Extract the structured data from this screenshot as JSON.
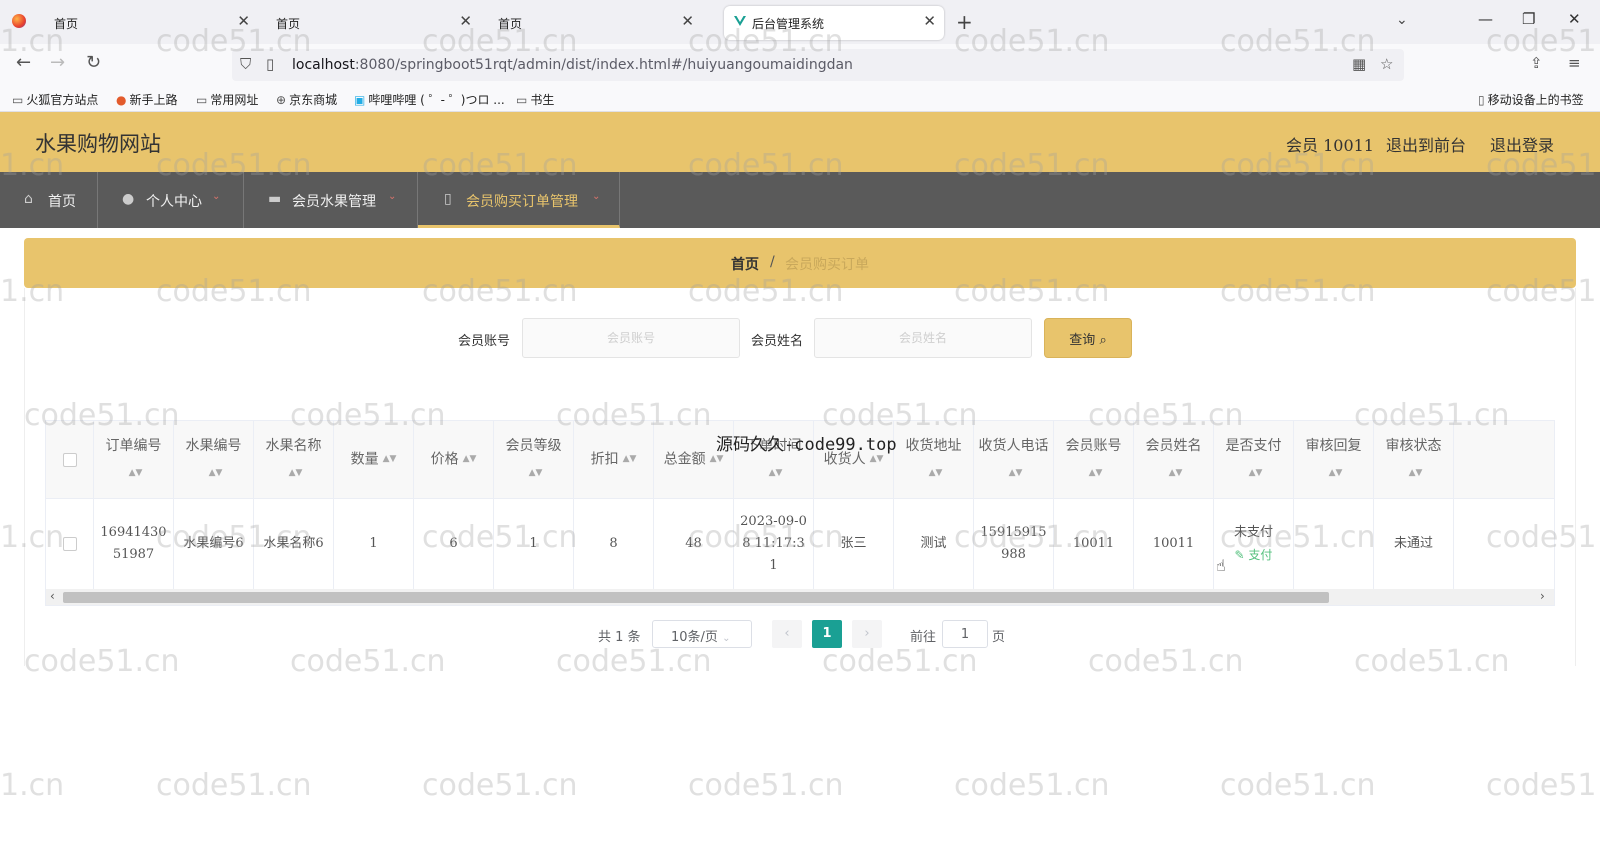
{
  "browser": {
    "tabs": [
      {
        "label": "首页",
        "close": "✕"
      },
      {
        "label": "首页",
        "close": "✕"
      },
      {
        "label": "首页",
        "close": "✕"
      },
      {
        "label": "后台管理系统",
        "close": "✕"
      }
    ],
    "new_tab": "+",
    "url_host": "localhost",
    "url_rest": ":8080/springboot51rqt/admin/dist/index.html#/huiyuangoumaidingdan",
    "bookmarks": [
      "火狐官方站点",
      "新手上路",
      "常用网址",
      "京东商城",
      "哔哩哔哩 ( ゜- ゜)つロ ...",
      "书生"
    ],
    "mobile_bookmarks": "移动设备上的书签"
  },
  "header": {
    "title": "水果购物网站",
    "member": "会员 10011",
    "to_front": "退出到前台",
    "logout": "退出登录"
  },
  "menu": [
    {
      "label": "首页",
      "icon": "home-icon"
    },
    {
      "label": "个人中心",
      "icon": "user-icon"
    },
    {
      "label": "会员水果管理",
      "icon": "briefcase-icon"
    },
    {
      "label": "会员购买订单管理",
      "icon": "phone-icon"
    }
  ],
  "breadcrumb": {
    "home": "首页",
    "separator": "/",
    "current": "会员购买订单"
  },
  "search": {
    "account_label": "会员账号",
    "account_placeholder": "会员账号",
    "name_label": "会员姓名",
    "name_placeholder": "会员姓名",
    "query_button": "查询"
  },
  "table": {
    "headers": [
      "订单编号",
      "水果编号",
      "水果名称",
      "数量",
      "价格",
      "会员等级",
      "折扣",
      "总金额",
      "下单时间",
      "收货人",
      "收货地址",
      "收货人电话",
      "会员账号",
      "会员姓名",
      "是否支付",
      "审核回复",
      "审核状态"
    ],
    "rows": [
      {
        "cells": [
          "1694143051987",
          "水果编号6",
          "水果名称6",
          "1",
          "6",
          "1",
          "8",
          "48",
          "2023-09-08 11:17:31",
          "张三",
          "测试",
          "15915915988",
          "10011",
          "10011",
          "未支付",
          "",
          "未通过"
        ],
        "pay_link": "支付"
      }
    ]
  },
  "pagination": {
    "total": "共 1 条",
    "page_size": "10条/页",
    "prev": "‹",
    "current": "1",
    "next": "›",
    "goto_prefix": "前往",
    "goto_value": "1",
    "goto_suffix": "页"
  },
  "watermark": "code51.cn",
  "watermark_short": "1.cn",
  "watermark_cut": "code51",
  "overlay_text": "源码久久-code99.top",
  "colors": {
    "accent": "#e8c46c",
    "menu_bg": "#5a5a5a",
    "active_page": "#1aa094",
    "pay_link": "#55c07e"
  }
}
